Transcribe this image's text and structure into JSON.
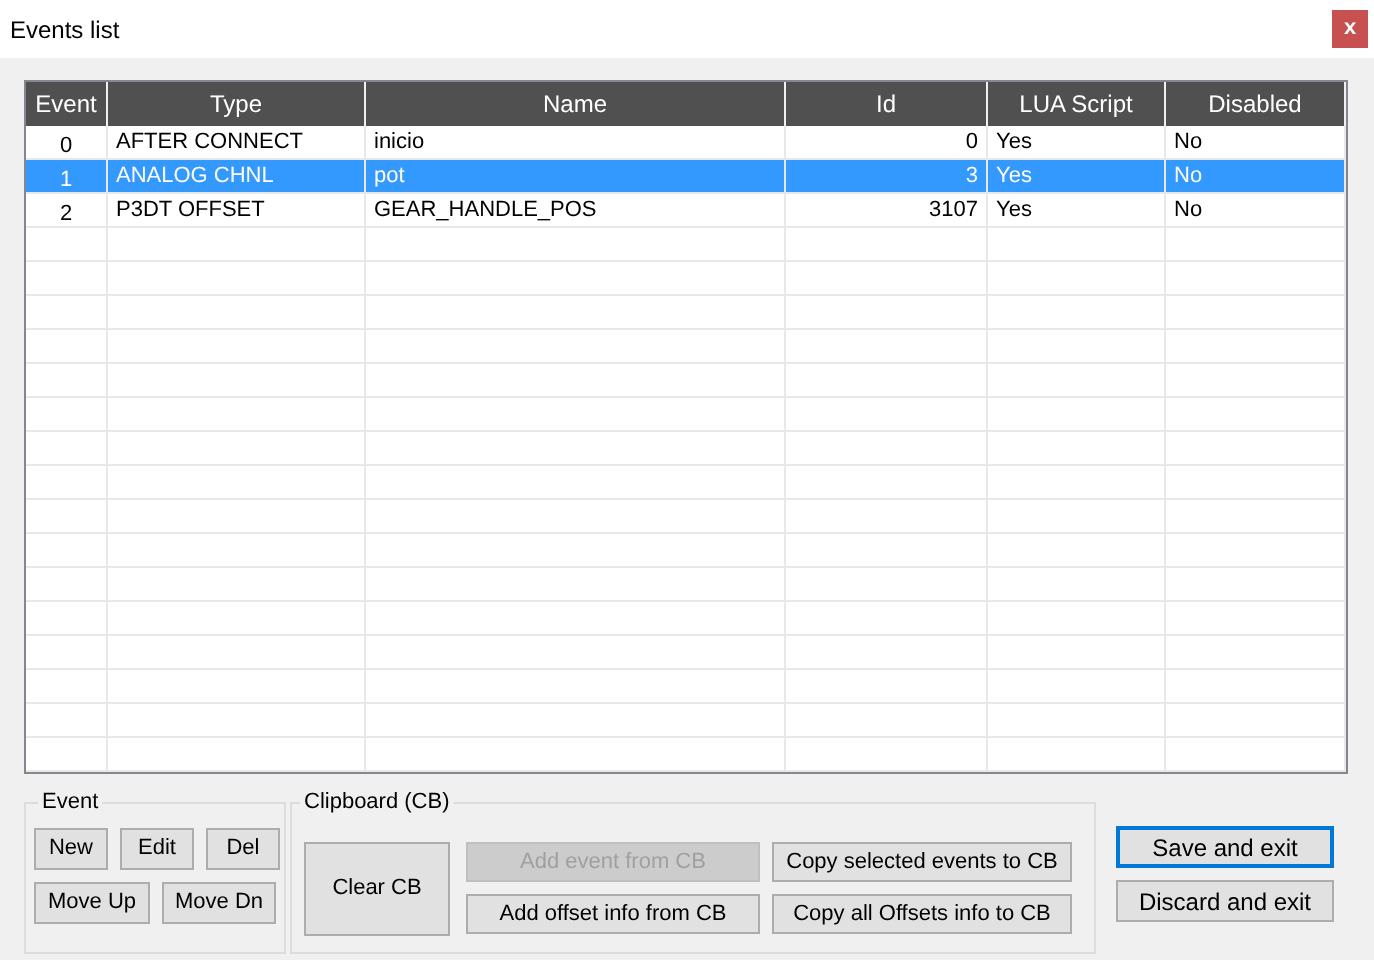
{
  "window": {
    "title": "Events list",
    "close": "x"
  },
  "table": {
    "columns": [
      "Event",
      "Type",
      "Name",
      "Id",
      "LUA Script",
      "Disabled"
    ],
    "rows": [
      {
        "cells": [
          "0",
          "AFTER CONNECT",
          "inicio",
          "0",
          "Yes",
          "No"
        ],
        "selected": false
      },
      {
        "cells": [
          "1",
          "ANALOG CHNL",
          "pot",
          "3",
          "Yes",
          "No"
        ],
        "selected": true
      },
      {
        "cells": [
          "2",
          "P3DT OFFSET",
          "GEAR_HANDLE_POS",
          "3107",
          "Yes",
          "No"
        ],
        "selected": false
      }
    ]
  },
  "event_group": {
    "title": "Event",
    "buttons": [
      {
        "label": "New",
        "disabled": false
      },
      {
        "label": "Edit",
        "disabled": false
      },
      {
        "label": "Del",
        "disabled": false
      },
      {
        "label": "Move Up",
        "disabled": false
      },
      {
        "label": "Move Dn",
        "disabled": false
      }
    ]
  },
  "clipboard_group": {
    "title": "Clipboard (CB)",
    "buttons": [
      {
        "label": "Clear CB",
        "disabled": false
      },
      {
        "label": "Add event from CB",
        "disabled": true
      },
      {
        "label": "Add offset info from CB",
        "disabled": false
      },
      {
        "label": "Copy selected events to CB",
        "disabled": false
      },
      {
        "label": "Copy all Offsets info to CB",
        "disabled": false
      }
    ]
  },
  "dialog_buttons": [
    {
      "label": "Save and exit",
      "focused": true
    },
    {
      "label": "Discard and exit",
      "focused": false
    }
  ]
}
